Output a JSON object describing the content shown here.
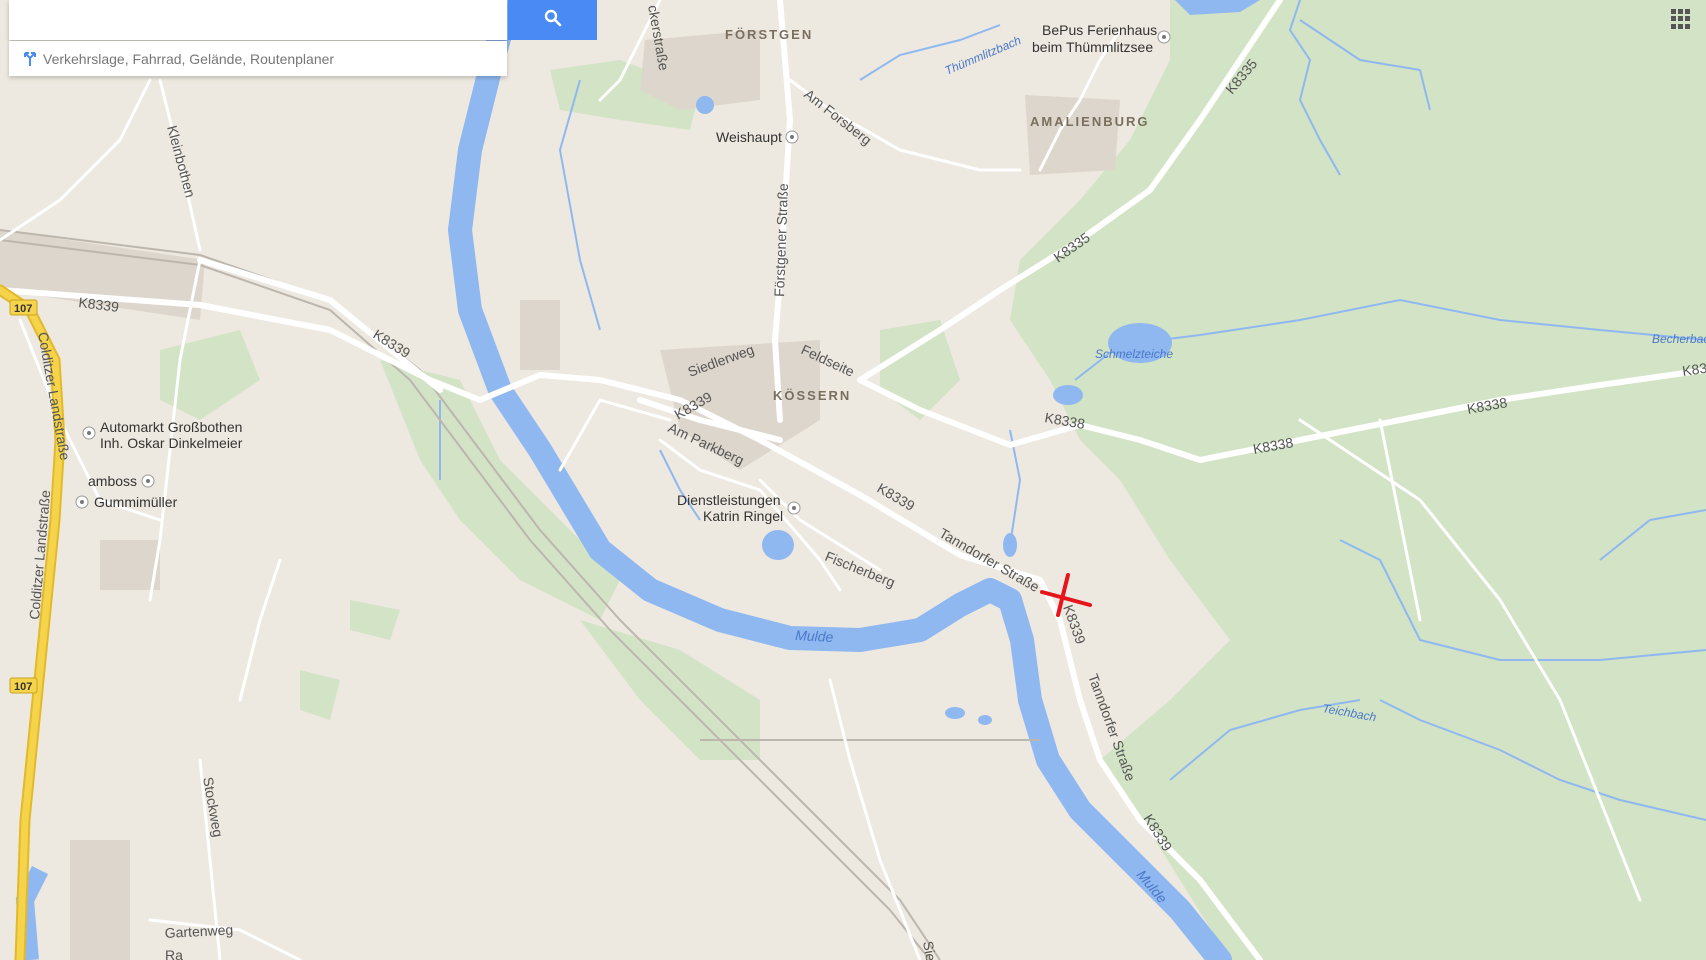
{
  "search": {
    "placeholder": "",
    "directions_hint": "Verkehrslage, Fahrrad, Gelände, Routenplaner",
    "button_icon": "search-icon"
  },
  "apps_icon": "apps-grid-icon",
  "colors": {
    "land": "#ede9e0",
    "forest": "#d3e3c6",
    "water": "#8fb8f0",
    "road": "#ffffff",
    "highway": "#f5d44c",
    "search_button": "#4a8af4",
    "marker": "#e8141b"
  },
  "labels": {
    "forstgen": "FÖRSTGEN",
    "koessern": "KÖSSERN",
    "amalienburg": "AMALIENBURG",
    "weishaupt": "Weishaupt",
    "bepus_1": "BePus Ferienhaus",
    "bepus_2": "beim Thümmlitzsee",
    "thuemmlitzbach": "Thümmlitzbach",
    "am_forsberg": "Am Forsberg",
    "foerstgener_strasse": "Förstgener Straße",
    "k8335_a": "K8335",
    "k8335_b": "K8335",
    "kleinbothen": "Kleinbothen",
    "k8339_a": "K8339",
    "k8339_b": "K8339",
    "k8339_c": "K8339",
    "k8339_d": "K8339",
    "k8339_e": "K8339",
    "k8339_f": "K8339",
    "siedlerweg": "Siedlerweg",
    "feldseite": "Feldseite",
    "am_parkberg": "Am Parkberg",
    "colditzer_1": "Colditzer Landstraße",
    "colditzer_2": "Colditzer Landstraße",
    "route_107_a": "107",
    "route_107_b": "107",
    "automarkt_1": "Automarkt Großbothen",
    "automarkt_2": "Inh. Oskar Dinkelmeier",
    "amboss": "amboss",
    "gummimueller": "Gummimüller",
    "dienstleistungen_1": "Dienstleistungen",
    "dienstleistungen_2": "Katrin Ringel",
    "fischerberg": "Fischerberg",
    "tanndorfer_a": "Tanndorfer Straße",
    "tanndorfer_b": "Tanndorfer Straße",
    "mulde_a": "Mulde",
    "mulde_b": "Mulde",
    "schmelzteiche": "Schmelzteiche",
    "k8338_a": "K8338",
    "k8338_b": "K8338",
    "k8338_c": "K8338",
    "k83_edge": "K83",
    "becherbach": "Becherbac",
    "teichbach": "Teichbach",
    "stockweg": "Stockweg",
    "gartenweg": "Gartenweg",
    "ckerstrasse": "ckerstraße",
    "sied": "Sied",
    "ra": "Ra"
  }
}
